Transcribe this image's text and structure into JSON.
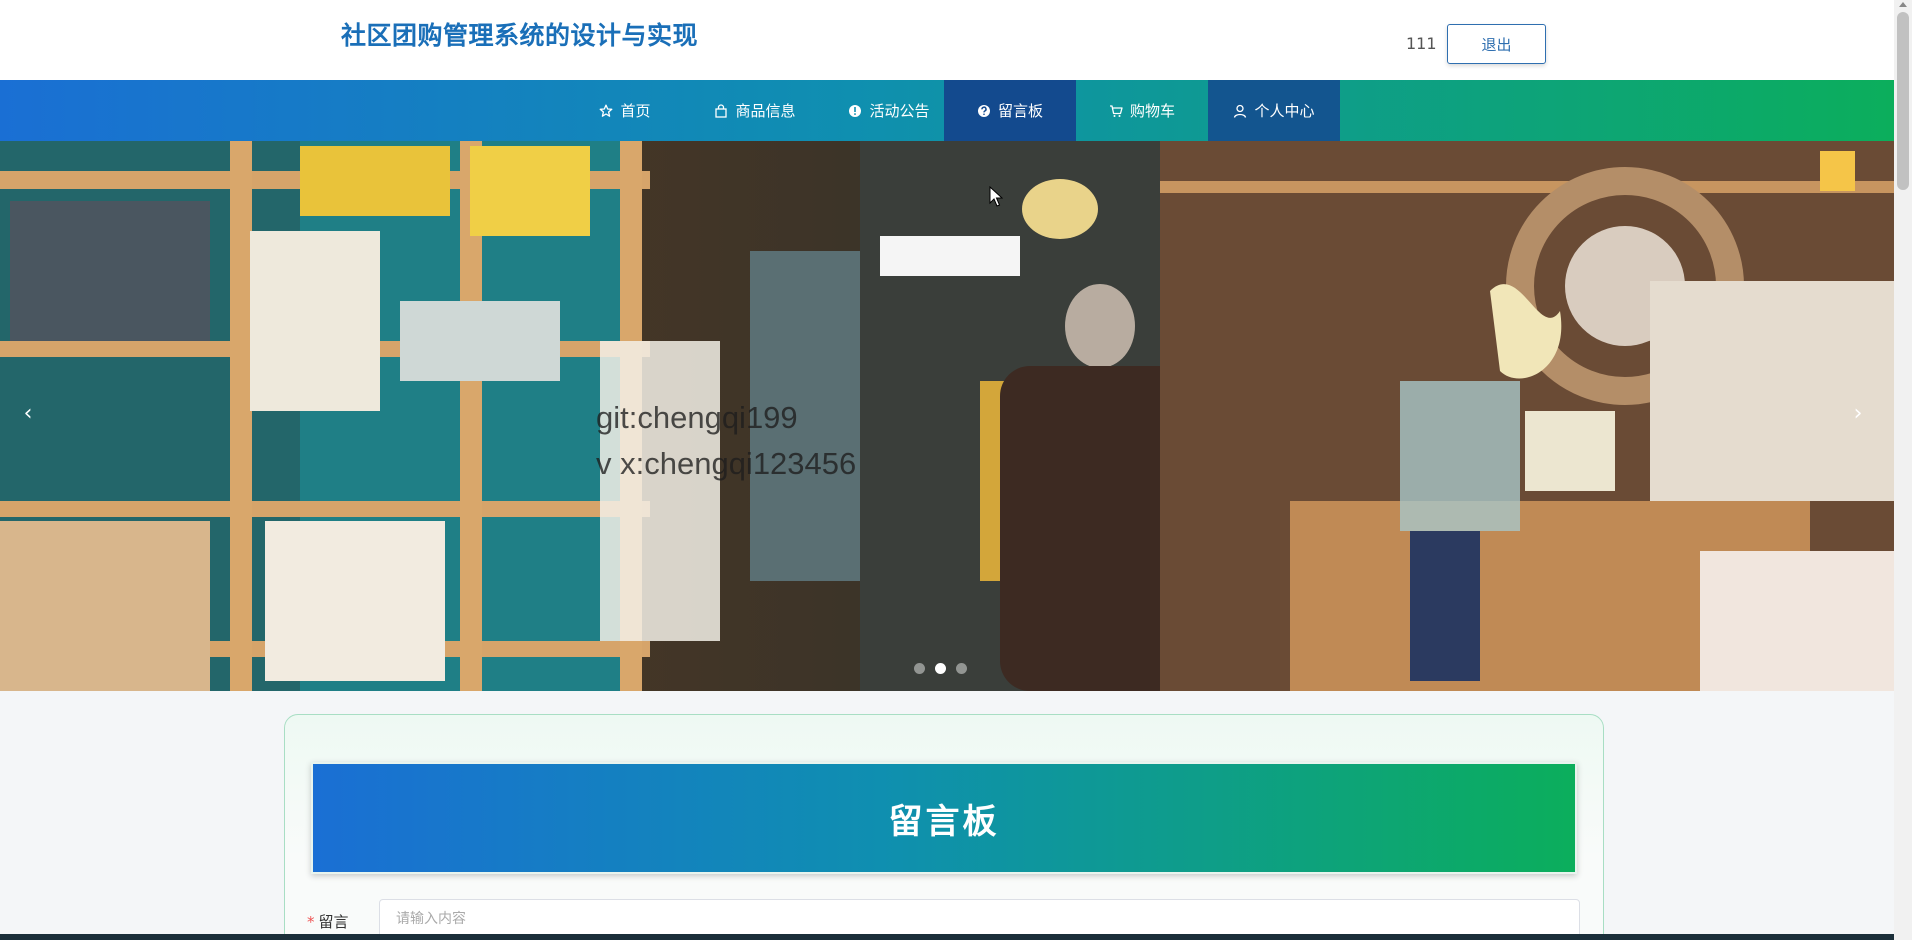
{
  "header": {
    "site_title": "社区团购管理系统的设计与实现",
    "username": "111",
    "logout_label": "退出"
  },
  "nav": {
    "items": [
      {
        "label": "首页",
        "icon": "star-icon"
      },
      {
        "label": "商品信息",
        "icon": "shopping-bag-icon"
      },
      {
        "label": "活动公告",
        "icon": "info-circle-icon"
      },
      {
        "label": "留言板",
        "icon": "question-circle-icon"
      },
      {
        "label": "购物车",
        "icon": "cart-icon"
      },
      {
        "label": "个人中心",
        "icon": "user-icon"
      }
    ],
    "active_item": "留言板"
  },
  "banner": {
    "watermark_line1": "git:chengqi199",
    "watermark_line2": "v x:chengqi123456",
    "prev_arrow": "‹",
    "next_arrow": "›",
    "slide_count": 3,
    "active_slide": 2
  },
  "board": {
    "title": "留言板",
    "field_label": "留言",
    "required_mark": "*",
    "input_placeholder": "请输入内容"
  },
  "colors": {
    "brand_blue": "#1a6fb8",
    "nav_start": "#1a6fd4",
    "nav_end": "#0cae5c",
    "nav_active": "#134a8e"
  }
}
